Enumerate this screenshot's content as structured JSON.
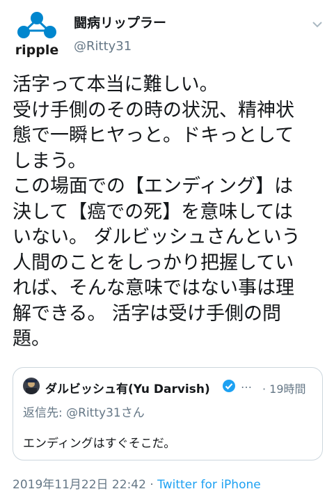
{
  "author": {
    "display_name": "闘病リップラー",
    "handle": "@Ritty31",
    "avatar_text": "ripple",
    "brand_color": "#0086ce"
  },
  "tweet": {
    "text": "活字って本当に難しい。\n受け手側のその時の状況、精神状\n態で一瞬ヒヤっと。ドキっとして\nしまう。\nこの場面での【エンディング】は\n決して【癌での死】を意味しては\nいない。 ダルビッシュさんという\n人間のことをしっかり把握してい\nれば、そんな意味ではない事は理\n解できる。 活字は受け手側の問\n題。"
  },
  "quoted": {
    "display_name": "ダルビッシュ有(Yu Darvish)",
    "ellipsis": "…",
    "time": "· 19時間",
    "reply_prefix": "返信先: ",
    "reply_handle": "@Ritty31さん",
    "text": "エンディングはすぐそこだ。",
    "verified_color": "#1da1f2"
  },
  "meta": {
    "timestamp": "2019年11月22日 22:42",
    "separator": "·",
    "source": "Twitter for iPhone",
    "link_color": "#1da1f2"
  },
  "icons": {
    "menu": "chevron-down-icon",
    "verified": "verified-badge-icon"
  }
}
